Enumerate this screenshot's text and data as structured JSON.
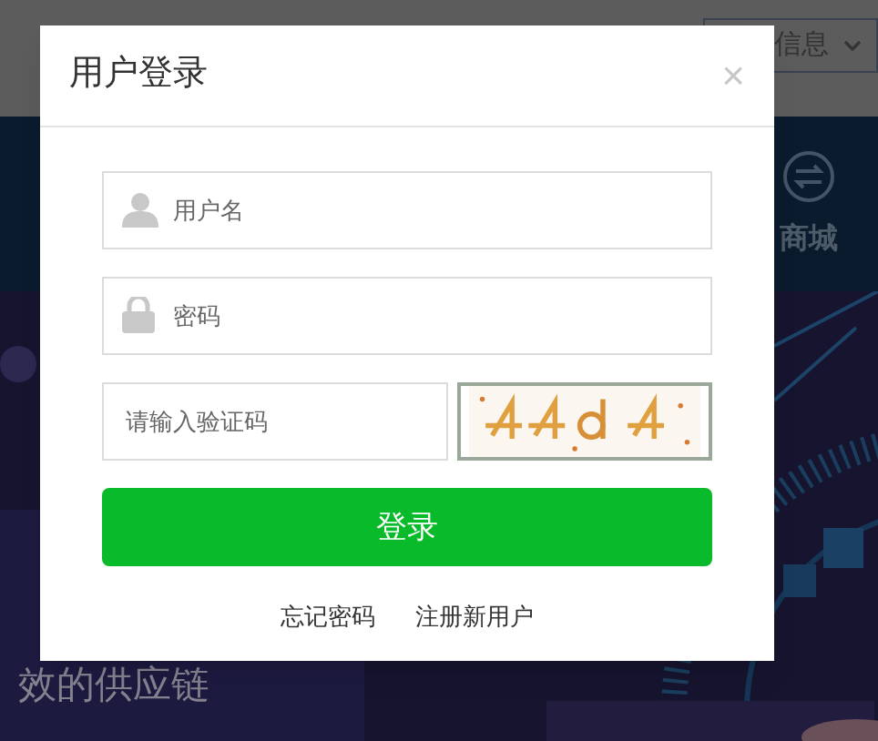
{
  "background": {
    "header_menu": {
      "label": "信息"
    },
    "nav_item": {
      "label": "商城"
    },
    "banner": {
      "subtitle": "效的供应链"
    }
  },
  "dialog": {
    "title": "用户登录",
    "close": "×",
    "fields": [
      {
        "kind": "username",
        "placeholder": "用户名"
      },
      {
        "kind": "password",
        "placeholder": "密码"
      }
    ],
    "captcha": {
      "placeholder": "请输入验证码"
    },
    "submit": "登录",
    "links": [
      "忘记密码",
      "注册新用户"
    ]
  }
}
